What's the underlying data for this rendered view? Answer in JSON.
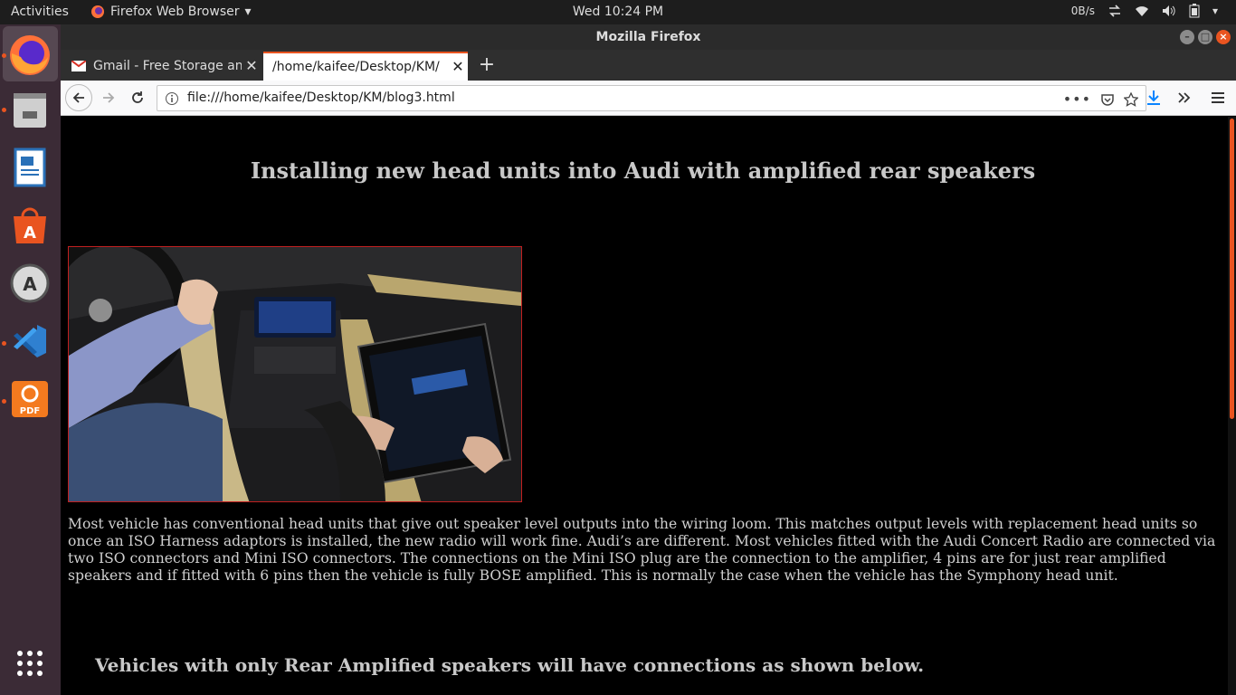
{
  "topbar": {
    "activities": "Activities",
    "app_menu": "Firefox Web Browser",
    "clock": "Wed 10:24 PM",
    "net_speed": "0B/s"
  },
  "dock": {
    "items": [
      "firefox-icon",
      "files-icon",
      "writer-icon",
      "software-center-icon",
      "software-updater-icon",
      "vscode-icon",
      "pdf-editor-icon",
      "show-apps-icon"
    ]
  },
  "window": {
    "title": "Mozilla Firefox"
  },
  "tabs": [
    {
      "label": "Gmail - Free Storage and",
      "active": false
    },
    {
      "label": "/home/kaifee/Desktop/KM/",
      "active": true
    }
  ],
  "urlbar": {
    "url": "file:///home/kaifee/Desktop/KM/blog3.html"
  },
  "page": {
    "title": "Installing new head units into Audi with amplified rear speakers",
    "paragraph": "Most vehicle has conventional head units that give out speaker level outputs into the wiring loom. This matches output levels with replacement head units so once an ISO Harness adaptors is installed, the new radio will work fine. Audi’s are different. Most vehicles fitted with the Audi Concert Radio are connected via two ISO connectors and Mini ISO connectors. The connections on the Mini ISO plug are the connection to the amplifier, 4 pins are for just rear amplified speakers and if fitted with 6 pins then the vehicle is fully BOSE amplified. This is normally the case when the vehicle has the Symphony head unit.",
    "subheading": "Vehicles with only Rear Amplified speakers will have connections as shown below."
  },
  "colors": {
    "accent": "#e95420",
    "page_background": "#000000",
    "text": "#d0d0d0",
    "dock": "#3b2b36"
  }
}
